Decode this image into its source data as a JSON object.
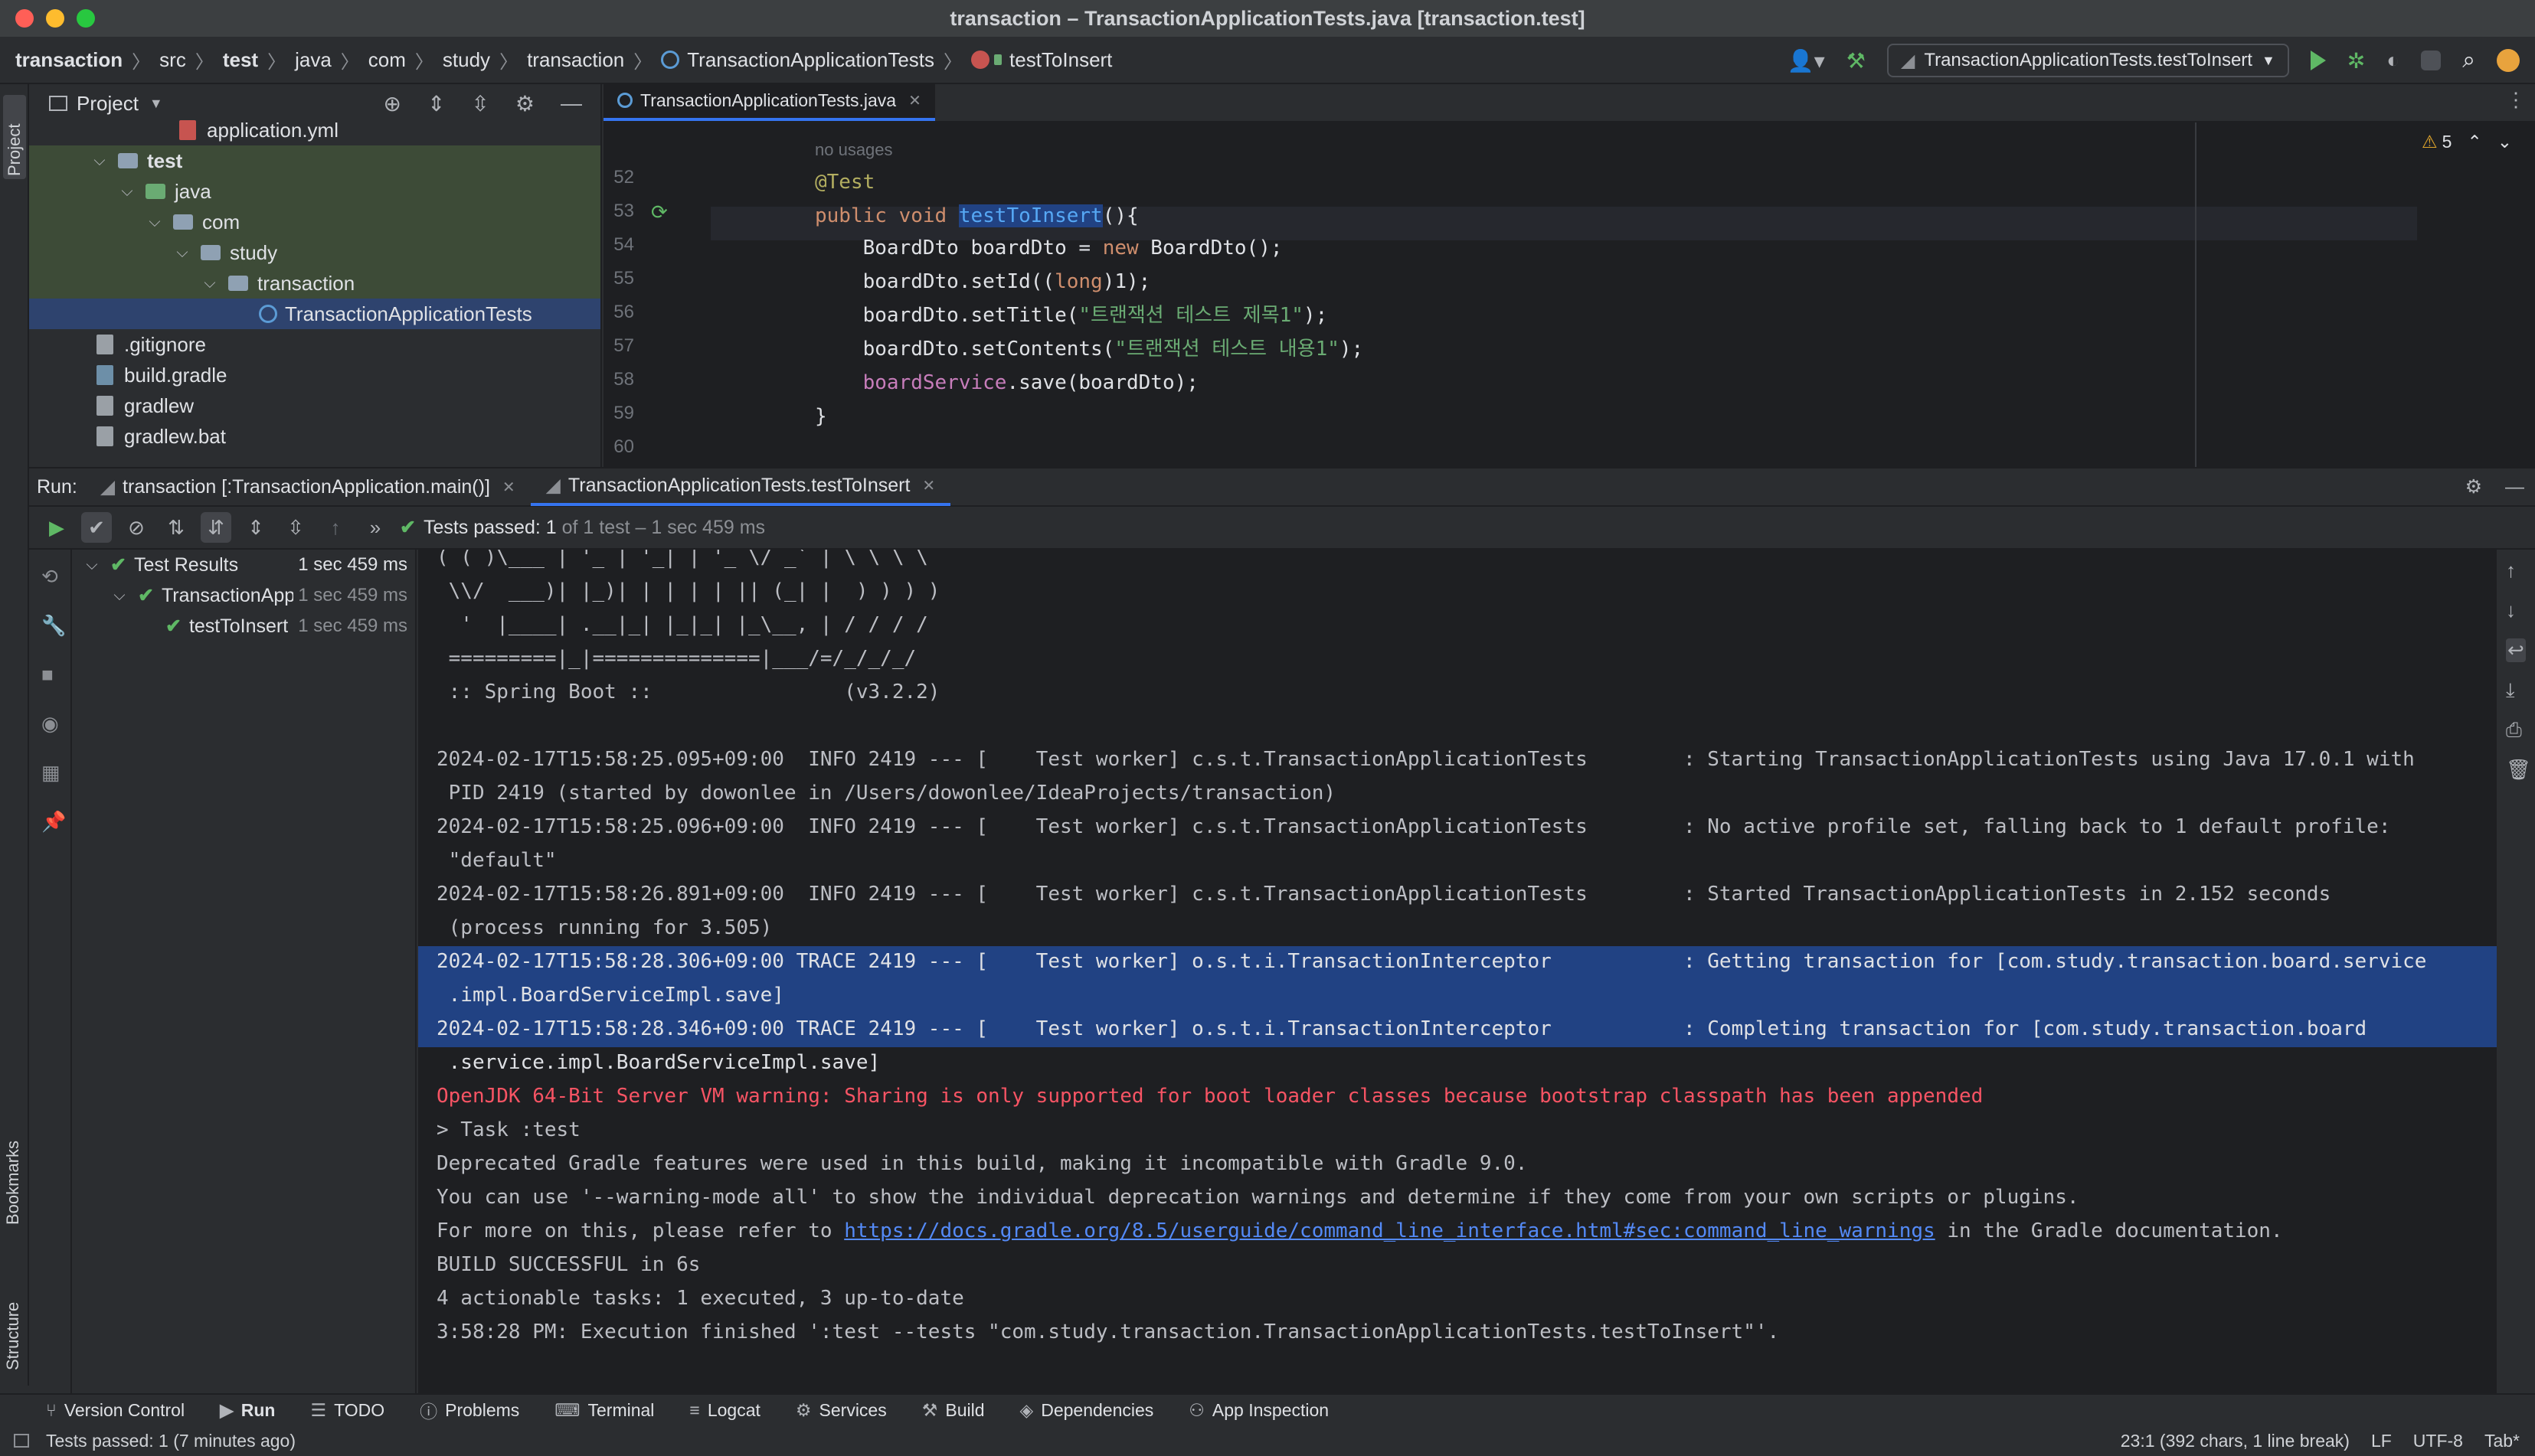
{
  "window": {
    "title": "transaction – TransactionApplicationTests.java [transaction.test]",
    "colors": {
      "close": "#ff5f57",
      "minimize": "#febc2e",
      "maximize": "#28c840",
      "accent": "#3574f0",
      "success": "#5fb865",
      "error": "#f75464"
    }
  },
  "breadcrumbs": [
    "transaction",
    "src",
    "test",
    "java",
    "com",
    "study",
    "transaction",
    "TransactionApplicationTests",
    "testToInsert"
  ],
  "run_config": {
    "label": "TransactionApplicationTests.testToInsert"
  },
  "project_panel": {
    "title": "Project",
    "items": [
      {
        "label": "application.yml"
      },
      {
        "label": "test"
      },
      {
        "label": "java"
      },
      {
        "label": "com"
      },
      {
        "label": "study"
      },
      {
        "label": "transaction"
      },
      {
        "label": "TransactionApplicationTests"
      },
      {
        "label": ".gitignore"
      },
      {
        "label": "build.gradle"
      },
      {
        "label": "gradlew"
      },
      {
        "label": "gradlew.bat"
      }
    ]
  },
  "editor": {
    "tab_label": "TransactionApplicationTests.java",
    "usage_hint": "no usages",
    "warnings_count": "5",
    "line_numbers": [
      "52",
      "53",
      "54",
      "55",
      "56",
      "57",
      "58",
      "59",
      "60"
    ],
    "lines": {
      "l52": "@Test",
      "l53_kw": "public void ",
      "l53_fn": "testToInsert",
      "l53_rest": "(){",
      "l54_a": "    BoardDto boardDto = ",
      "l54_kw": "new",
      "l54_b": " BoardDto();",
      "l55_a": "    boardDto.setId((",
      "l55_kw": "long",
      "l55_b": ")1);",
      "l56_a": "    boardDto.setTitle(",
      "l56_str": "\"트랜잭션 테스트 제목1\"",
      "l56_b": ");",
      "l57_a": "    boardDto.setContents(",
      "l57_str": "\"트랜잭션 테스트 내용1\"",
      "l57_b": ");",
      "l58_fld": "    boardService",
      "l58_b": ".save(boardDto);",
      "l59": "}"
    }
  },
  "run": {
    "label": "Run:",
    "tabs": [
      {
        "label": "transaction [:TransactionApplication.main()]"
      },
      {
        "label": "TransactionApplicationTests.testToInsert"
      }
    ],
    "status_prefix": "Tests passed: ",
    "status_count": "1",
    "status_suffix": " of 1 test – 1 sec 459 ms",
    "test_results": [
      {
        "label": "Test Results",
        "time": "1 sec 459 ms"
      },
      {
        "label": "TransactionApplicationTests",
        "time": "1 sec 459 ms"
      },
      {
        "label": "testToInsert",
        "time": "1 sec 459 ms"
      }
    ],
    "console": {
      "banner": [
        "( ( )\\___ | '_ | '_| | '_ \\/ _` | \\ \\ \\ \\",
        " \\\\/  ___)| |_)| | | | | || (_| |  ) ) ) )",
        "  '  |____| .__|_| |_|_| |_\\__, | / / / /",
        " =========|_|==============|___/=/_/_/_/",
        " :: Spring Boot ::                (v3.2.2)"
      ],
      "log": [
        "2024-02-17T15:58:25.095+09:00  INFO 2419 --- [    Test worker] c.s.t.TransactionApplicationTests        : Starting TransactionApplicationTests using Java 17.0.1 with",
        " PID 2419 (started by dowonlee in /Users/dowonlee/IdeaProjects/transaction)",
        "2024-02-17T15:58:25.096+09:00  INFO 2419 --- [    Test worker] c.s.t.TransactionApplicationTests        : No active profile set, falling back to 1 default profile:",
        " \"default\"",
        "2024-02-17T15:58:26.891+09:00  INFO 2419 --- [    Test worker] c.s.t.TransactionApplicationTests        : Started TransactionApplicationTests in 2.152 seconds",
        " (process running for 3.505)",
        "2024-02-17T15:58:28.306+09:00 TRACE 2419 --- [    Test worker] o.s.t.i.TransactionInterceptor           : Getting transaction for [com.study.transaction.board.service",
        " .impl.BoardServiceImpl.save]",
        "2024-02-17T15:58:28.346+09:00 TRACE 2419 --- [    Test worker] o.s.t.i.TransactionInterceptor           : Completing transaction for [com.study.transaction.board",
        " .service.impl.BoardServiceImpl.save]"
      ],
      "warning": "OpenJDK 64-Bit Server VM warning: Sharing is only supported for boot loader classes because bootstrap classpath has been appended",
      "task": "> Task :test",
      "deprecated": "Deprecated Gradle features were used in this build, making it incompatible with Gradle 9.0.",
      "warning_mode": "You can use '--warning-mode all' to show the individual deprecation warnings and determine if they come from your own scripts or plugins.",
      "more_prefix": "For more on this, please refer to ",
      "more_link": "https://docs.gradle.org/8.5/userguide/command_line_interface.html#sec:command_line_warnings",
      "more_suffix": " in the Gradle documentation.",
      "build": "BUILD SUCCESSFUL in 6s",
      "actionable": "4 actionable tasks: 1 executed, 3 up-to-date",
      "finished": "3:58:28 PM: Execution finished ':test --tests \"com.study.transaction.TransactionApplicationTests.testToInsert\"'."
    }
  },
  "left_strip": {
    "project": "Project",
    "bookmarks": "Bookmarks",
    "structure": "Structure"
  },
  "bottom_tools": [
    "Version Control",
    "Run",
    "TODO",
    "Problems",
    "Terminal",
    "Logcat",
    "Services",
    "Build",
    "Dependencies",
    "App Inspection"
  ],
  "status_bar": {
    "message": "Tests passed: 1 (7 minutes ago)",
    "position": "23:1 (392 chars, 1 line break)",
    "line_sep": "LF",
    "encoding": "UTF-8",
    "indent": "Tab*"
  }
}
